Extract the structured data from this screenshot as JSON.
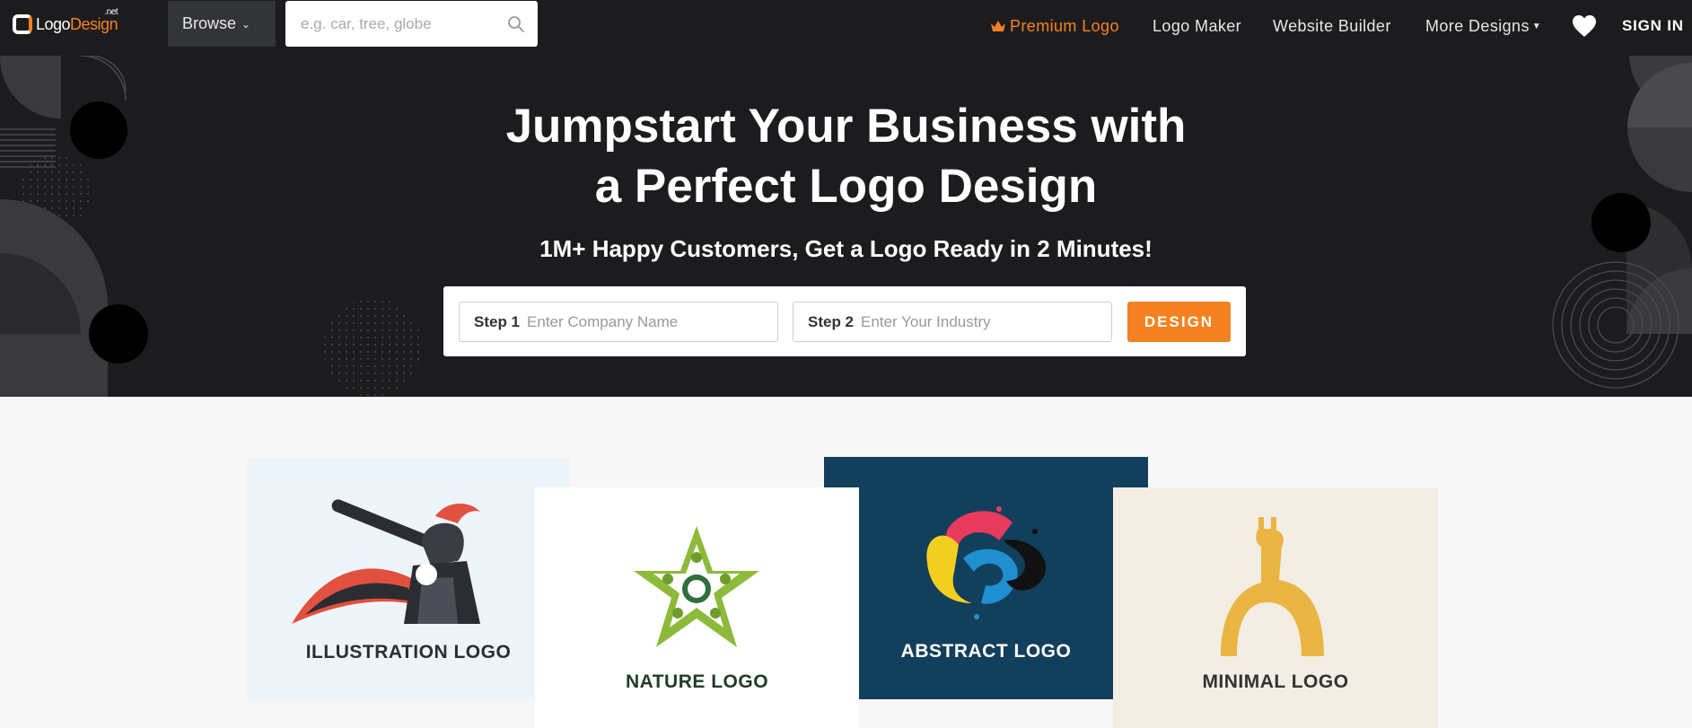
{
  "brand": {
    "name_part1": "Logo",
    "name_part2": "Design",
    "suffix": ".net"
  },
  "nav": {
    "browse_label": "Browse",
    "search_placeholder": "e.g. car, tree, globe",
    "premium_label": "Premium Logo",
    "logo_maker_label": "Logo Maker",
    "website_builder_label": "Website Builder",
    "more_designs_label": "More Designs",
    "sign_in_label": "SIGN IN"
  },
  "hero": {
    "title_line1": "Jumpstart Your Business with",
    "title_line2": "a Perfect Logo Design",
    "subtitle": "1M+ Happy Customers, Get a Logo Ready in 2 Minutes!",
    "step1_label": "Step 1",
    "step1_placeholder": "Enter Company Name",
    "step2_label": "Step 2",
    "step2_placeholder": "Enter Your Industry",
    "design_button": "DESIGN"
  },
  "cards": [
    {
      "caption": "ILLUSTRATION LOGO"
    },
    {
      "caption": "NATURE LOGO"
    },
    {
      "caption": "ABSTRACT LOGO"
    },
    {
      "caption": "MINIMAL LOGO"
    }
  ],
  "colors": {
    "accent": "#f58220",
    "nav_bg": "#1c1c1e",
    "page_bg": "#f7f7f7",
    "abstract_card_bg": "#123f5c",
    "minimal_card_bg": "#f3eee4",
    "illustration_card_bg": "#eef5fa"
  },
  "icons": [
    "search-icon",
    "chevron-down-icon",
    "crown-icon",
    "caret-down-icon",
    "heart-icon"
  ]
}
